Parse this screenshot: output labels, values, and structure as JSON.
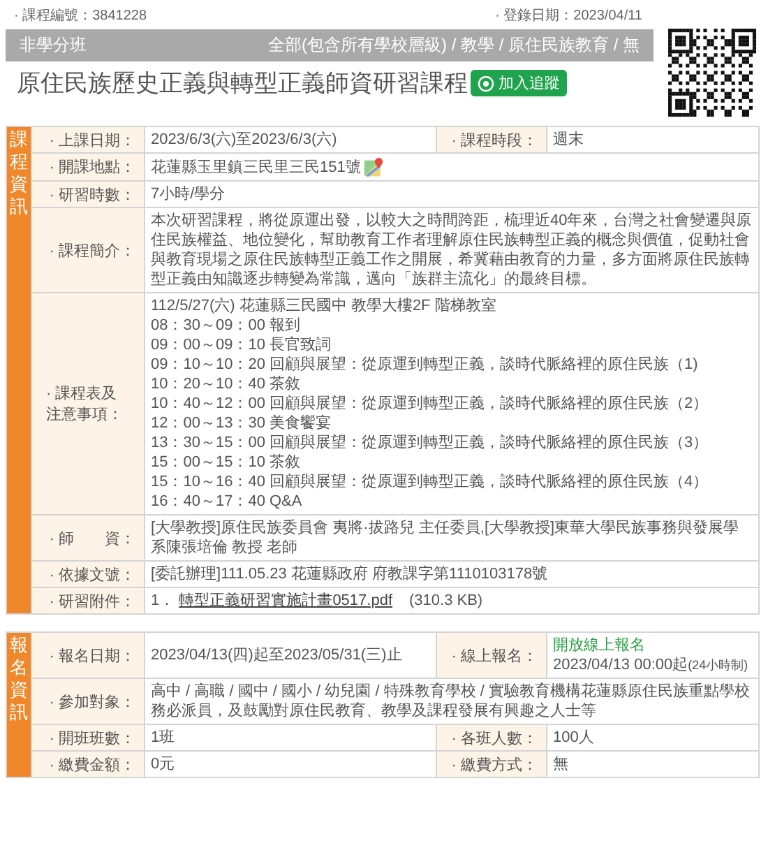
{
  "header": {
    "course_no": "· 課程編號：3841228",
    "registered": "· 登錄日期：2023/04/11"
  },
  "banner": {
    "type": "非學分班",
    "category": "全部(包含所有學校層級) / 教學 / 原住民族教育 / 無"
  },
  "title": "原住民族歷史正義與轉型正義師資研習課程",
  "follow_button": "加入追蹤",
  "sections": [
    {
      "label": "課程資訊",
      "rows": [
        [
          {
            "label": "· 上課日期：",
            "kind": "text",
            "value": "2023/6/3(六)至2023/6/3(六)"
          },
          {
            "label": "· 課程時段：",
            "kind": "text",
            "value": "週末"
          }
        ],
        [
          {
            "label": "· 開課地點：",
            "kind": "map",
            "value": "花蓮縣玉里鎮三民里三民151號"
          }
        ],
        [
          {
            "label": "· 研習時數：",
            "kind": "text",
            "value": "7小時/學分"
          }
        ],
        [
          {
            "label": "· 課程簡介：",
            "kind": "text",
            "value": "本次研習課程，將從原運出發，以較大之時間跨距，梳理近40年來，台灣之社會變遷與原住民族權益、地位變化，幫助教育工作者理解原住民族轉型正義的概念與價值，促動社會與教育現場之原住民族轉型正義工作之開展，希冀藉由教育的力量，多方面將原住民族轉型正義由知識逐步轉變為常識，邁向「族群主流化」的最終目標。"
          }
        ],
        [
          {
            "label": [
              "· 課程表及",
              "注意事項："
            ],
            "kind": "lines",
            "lines": [
              "112/5/27(六) 花蓮縣三民國中 教學大樓2F 階梯教室",
              "08：30～09：00 報到",
              "09：00～09：10 長官致詞",
              "09：10～10：20 回顧與展望：從原運到轉型正義，談時代脈絡裡的原住民族（1)",
              "10：20～10：40 茶敘",
              "10：40～12：00 回顧與展望：從原運到轉型正義，談時代脈絡裡的原住民族（2）",
              "12：00～13：30 美食饗宴",
              "13：30～15：00 回顧與展望：從原運到轉型正義，談時代脈絡裡的原住民族（3）",
              "15：00～15：10 茶敘",
              "15：10～16：40 回顧與展望：從原運到轉型正義，談時代脈絡裡的原住民族（4）",
              "16：40～17：40 Q&A"
            ]
          }
        ],
        [
          {
            "label": "· 師　　資：",
            "kind": "text",
            "value": "[大學教授]原住民族委員會 夷將·拔路兒 主任委員,[大學教授]東華大學民族事務與發展學系陳張培倫 教授 老師"
          }
        ],
        [
          {
            "label": "· 依據文號：",
            "kind": "text",
            "value": "[委託辦理]111.05.23 花蓮縣政府 府教課字第1110103178號"
          }
        ],
        [
          {
            "label": "· 研習附件：",
            "kind": "attachment",
            "index": "1．",
            "link": "轉型正義研習實施計畫0517.pdf",
            "size": "(310.3 KB)"
          }
        ]
      ]
    },
    {
      "label": "報名資訊",
      "rows": [
        [
          {
            "label": "· 報名日期：",
            "kind": "text",
            "value": "2023/04/13(四)起至2023/05/31(三)止"
          },
          {
            "label": "· 線上報名：",
            "kind": "signup",
            "status": "開放線上報名",
            "value": "2023/04/13 00:00起",
            "note": "(24小時制)"
          }
        ],
        [
          {
            "label": "· 參加對象：",
            "kind": "text",
            "value": "高中 / 高職 / 國中 / 國小 / 幼兒園 / 特殊教育學校 / 實驗教育機構花蓮縣原住民族重點學校務必派員，及鼓勵對原住民教育、教學及課程發展有興趣之人士等"
          }
        ],
        [
          {
            "label": "· 開班班數：",
            "kind": "text",
            "value": "1班"
          },
          {
            "label": "· 各班人數：",
            "kind": "text",
            "value": "100人"
          }
        ],
        [
          {
            "label": "· 繳費金額：",
            "kind": "text",
            "value": "0元"
          },
          {
            "label": "· 繳費方式：",
            "kind": "text",
            "value": "無"
          }
        ]
      ]
    }
  ]
}
